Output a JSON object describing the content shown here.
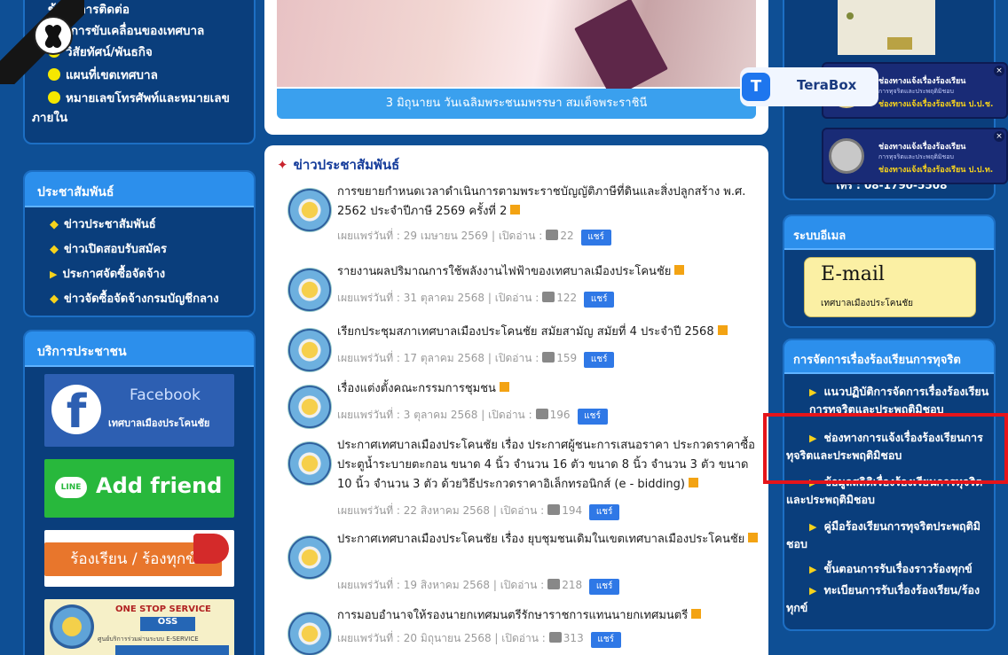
{
  "left": {
    "top_links": [
      "ข้อมูลการติดต่อ",
      "แผนการขับเคลื่อนของเทศบาล",
      "วิสัยทัศน์/พันธกิจ",
      "แผนที่เขตเทศบาล",
      "หมายเลขโทรศัพท์และหมายเลข",
      "ภายใน"
    ],
    "pr_box": {
      "title": "ประชาสัมพันธ์",
      "items": [
        "ข่าวประชาสัมพันธ์",
        "ข่าวเปิดสอบรับสมัคร",
        "ประกาศจัดซื้อจัดจ้าง",
        "ข่าวจัดซื้อจัดจ้างกรมบัญชีกลาง"
      ]
    },
    "service_box": {
      "title": "บริการประชาชน",
      "facebook_title": "Facebook",
      "facebook_sub": "เทศบาลเมืองประโคนชัย",
      "line_badge": "LINE",
      "line_label": "Add friend",
      "complaint_label": "ร้องเรียน / ร้องทุกข์",
      "oss_top": "ONE STOP SERVICE",
      "oss_badge": "OSS",
      "oss_sub": "ศูนย์บริการร่วมผ่านระบบ E-SERVICE"
    }
  },
  "banner": {
    "caption": "3 มิถุนายน วันเฉลิมพระชนมพรรษา สมเด็จพระราชินี"
  },
  "news": {
    "title": "ข่าวประชาสัมพันธ์",
    "published_label": "เผยแพร่วันที่ :",
    "read_label": "เปิดอ่าน :",
    "share_label": "แชร์",
    "items": [
      {
        "title": "การขยายกำหนดเวลาดำเนินการตามพระราชบัญญัติภาษีที่ดินและสิ่งปลูกสร้าง พ.ศ. 2562 ประจำปีภาษี 2569 ครั้งที่ 2",
        "date": "29 เมษายน 2569",
        "views": "22"
      },
      {
        "title": "รายงานผลปริมาณการใช้พลังงานไฟฟ้าของเทศบาลเมืองประโคนชัย",
        "date": "31 ตุลาคม 2568",
        "views": "122"
      },
      {
        "title": "เรียกประชุมสภาเทศบาลเมืองประโคนชัย สมัยสามัญ สมัยที่ 4 ประจำปี 2568",
        "date": "17 ตุลาคม 2568",
        "views": "159"
      },
      {
        "title": "เรื่องแต่งตั้งคณะกรรมการชุมชน",
        "date": "3 ตุลาคม 2568",
        "views": "196"
      },
      {
        "title": "ประกาศเทศบาลเมืองประโคนชัย เรื่อง ประกาศผู้ชนะการเสนอราคา ประกวดราคาซื้อประตูน้ำระบายตะกอน ขนาด 4 นิ้ว จำนวน 16 ตัว ขนาด 8 นิ้ว จำนวน 3 ตัว ขนาด 10 นิ้ว จำนวน 3 ตัว ด้วยวิธีประกวดราคาอิเล็กทรอนิกส์ (e - bidding)",
        "date": "22 สิงหาคม 2568",
        "views": "194"
      },
      {
        "title": "ประกาศเทศบาลเมืองประโคนชัย เรื่อง ยุบชุมชนเดิมในเขตเทศบาลเมืองประโคนชัย",
        "date": "19 สิงหาคม 2568",
        "views": "218"
      },
      {
        "title": "การมอบอำนาจให้รองนายกเทศมนตรีรักษาราชการแทนนายกเทศมนตรี",
        "date": "20 มิถุนายน 2568",
        "views": "313"
      }
    ]
  },
  "right": {
    "phone_partial": "โทร : 08-1790-5508",
    "terabox_label": "TeraBox",
    "complaint_cards": [
      {
        "line1": "ช่องทางแจ้งเรื่องร้องเรียน",
        "line2": "การทุจริตและประพฤติมิชอบ",
        "line3": "ช่องทางแจ้งเรื่องร้องเรียน ป.ป.ช."
      },
      {
        "line1": "ช่องทางแจ้งเรื่องร้องเรียน",
        "line2": "การทุจริตและประพฤติมิชอบ",
        "line3": "ช่องทางแจ้งเรื่องร้องเรียน ป.ป.ท."
      }
    ],
    "email_box": {
      "title": "ระบบอีเมล",
      "email_label": "E-mail",
      "email_sub": "เทศบาลเมืองประโคนชัย"
    },
    "corruption_box": {
      "title": "การจัดการเรื่องร้องเรียนการทุจริต",
      "items": [
        [
          "แนวปฏิบัติการจัดการเรื่องร้องเรียน",
          "การทุจริตและประพฤติมิชอบ"
        ],
        [
          "ช่องทางการแจ้งเรื่องร้องเรียนการ",
          "ทุจริตและประพฤติมิชอบ"
        ],
        [
          "ข้อมูลสถิติเรื่องร้องเรียนการทุจริต",
          "และประพฤติมิชอบ"
        ],
        [
          "คู่มือร้องเรียนการทุจริตประพฤติมิ",
          "ชอบ"
        ],
        [
          "ขั้นตอนการรับเรื่องราวร้องทุกข์"
        ],
        [
          "ทะเบียนการรับเรื่องร้องเรียน/ร้อง",
          "ทุกข์"
        ]
      ]
    }
  }
}
